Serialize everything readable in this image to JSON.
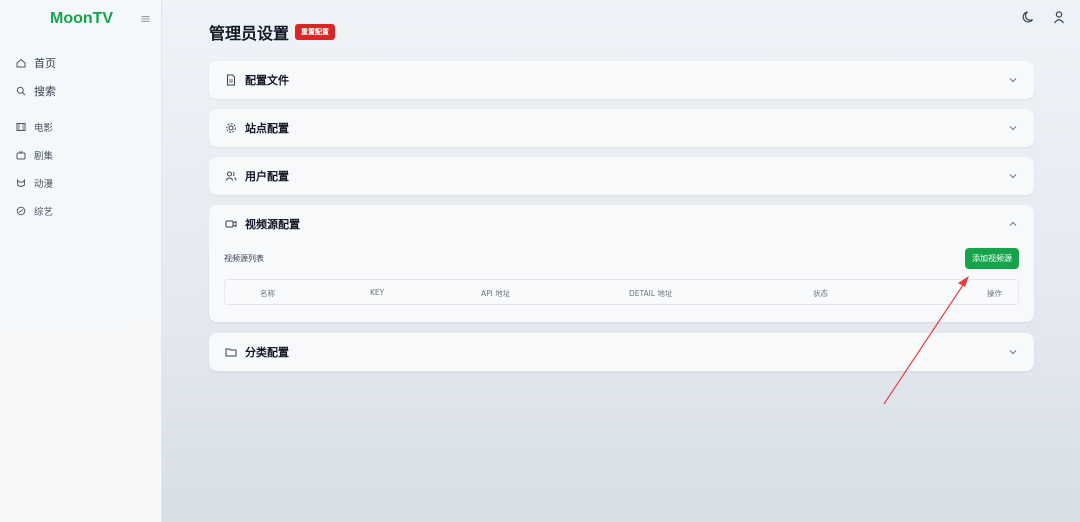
{
  "brand": "MoonTV",
  "sidebar": {
    "items": [
      {
        "label": "首页",
        "icon": "home-icon"
      },
      {
        "label": "搜索",
        "icon": "search-icon"
      },
      {
        "label": "电影",
        "icon": "film-icon"
      },
      {
        "label": "剧集",
        "icon": "tv-icon"
      },
      {
        "label": "动漫",
        "icon": "cat-icon"
      },
      {
        "label": "综艺",
        "icon": "sparkle-icon"
      }
    ]
  },
  "page": {
    "title": "管理员设置",
    "reset_label": "重置配置"
  },
  "panels": {
    "config_file": "配置文件",
    "site": "站点配置",
    "user": "用户配置",
    "video_source": "视频源配置",
    "category": "分类配置"
  },
  "video_source": {
    "list_title": "视频源列表",
    "add_label": "添加视频源",
    "columns": [
      "名称",
      "KEY",
      "API 地址",
      "DETAIL 地址",
      "状态",
      "操作"
    ]
  },
  "colors": {
    "accent": "#16a34a",
    "danger": "#dc2626",
    "arrow": "#e53e3e"
  }
}
